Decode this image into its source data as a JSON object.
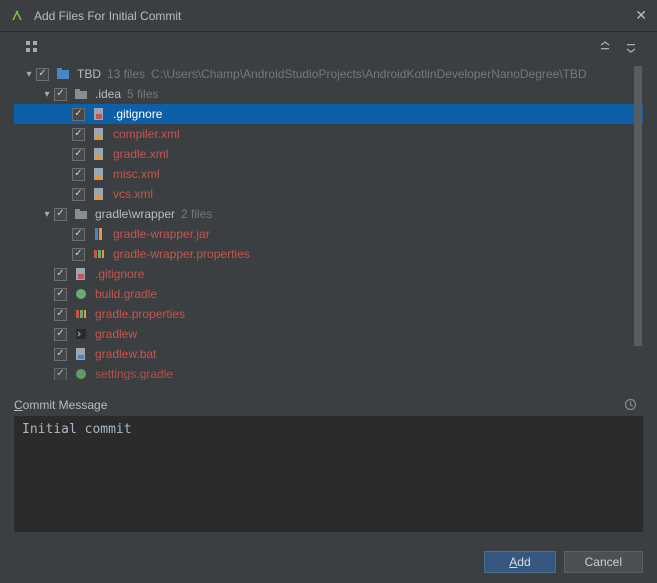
{
  "window": {
    "title": "Add Files For Initial Commit"
  },
  "tree": {
    "root": {
      "name": "TBD",
      "files_count": "13 files",
      "path": "C:\\Users\\Champ\\AndroidStudioProjects\\AndroidKotlinDeveloperNanoDegree\\TBD"
    },
    "idea": {
      "name": ".idea",
      "files_count": "5 files",
      "children": [
        ".gitignore",
        "compiler.xml",
        "gradle.xml",
        "misc.xml",
        "vcs.xml"
      ]
    },
    "wrapper": {
      "name": "gradle\\wrapper",
      "files_count": "2 files",
      "children": [
        "gradle-wrapper.jar",
        "gradle-wrapper.properties"
      ]
    },
    "root_files": [
      ".gitignore",
      "build.gradle",
      "gradle.properties",
      "gradlew",
      "gradlew.bat",
      "settings.gradle"
    ]
  },
  "commit": {
    "label_pre": "C",
    "label_rest": "ommit Message",
    "value": "Initial commit"
  },
  "buttons": {
    "add_pre": "A",
    "add_rest": "dd",
    "cancel": "Cancel"
  }
}
